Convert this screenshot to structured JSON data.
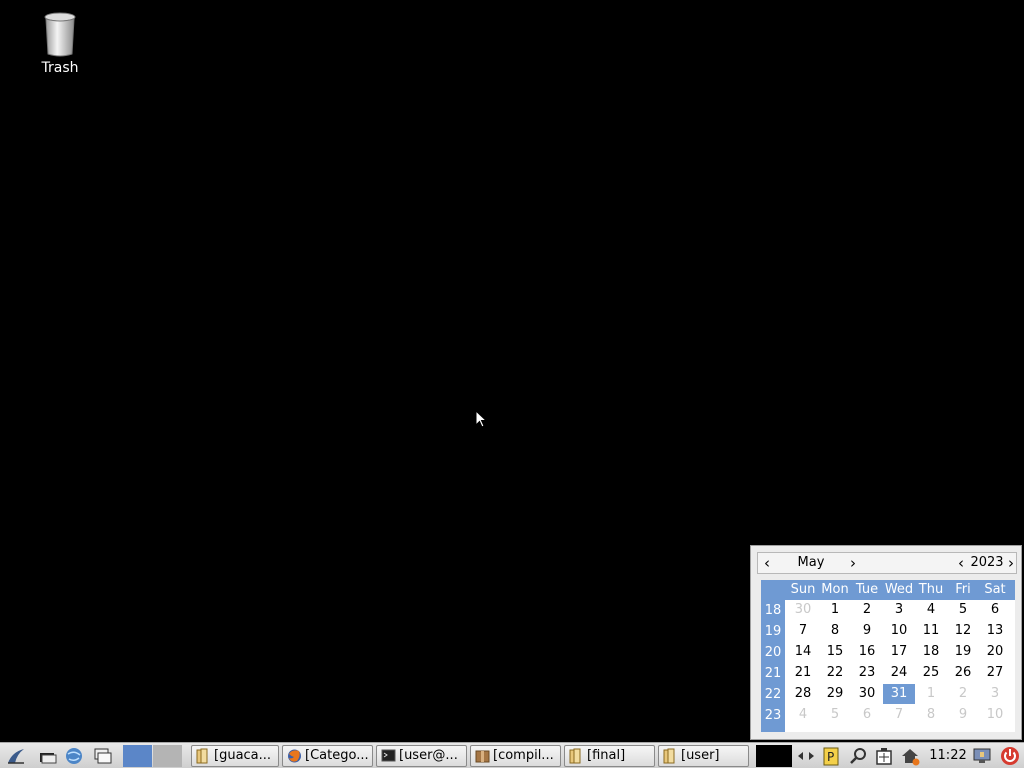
{
  "desktop": {
    "icons": [
      {
        "label": "Trash",
        "icon": "trash-icon"
      }
    ]
  },
  "calendar": {
    "month": "May",
    "year": "2023",
    "prev_arrow": "‹",
    "next_arrow": "›",
    "day_headers": [
      "Sun",
      "Mon",
      "Tue",
      "Wed",
      "Thu",
      "Fri",
      "Sat"
    ],
    "week_numbers": [
      "18",
      "19",
      "20",
      "21",
      "22",
      "23"
    ],
    "weeks": [
      [
        "30",
        "1",
        "2",
        "3",
        "4",
        "5",
        "6"
      ],
      [
        "7",
        "8",
        "9",
        "10",
        "11",
        "12",
        "13"
      ],
      [
        "14",
        "15",
        "16",
        "17",
        "18",
        "19",
        "20"
      ],
      [
        "21",
        "22",
        "23",
        "24",
        "25",
        "26",
        "27"
      ],
      [
        "28",
        "29",
        "30",
        "31",
        "1",
        "2",
        "3"
      ],
      [
        "4",
        "5",
        "6",
        "7",
        "8",
        "9",
        "10"
      ]
    ],
    "selected_day": "31",
    "colors": {
      "header_bg": "#6f9ad3",
      "selected_bg": "#6f9ad3",
      "other_month": "#c8c8c8"
    }
  },
  "taskbar": {
    "launchers": [
      "menu-icon",
      "file-manager-icon",
      "browser-icon",
      "show-desktop-icon"
    ],
    "tasks": [
      {
        "label": "[guaca...",
        "icon": "folder-icon"
      },
      {
        "label": "[Catego...",
        "icon": "firefox-icon"
      },
      {
        "label": "[user@...",
        "icon": "terminal-icon"
      },
      {
        "label": "[compil...",
        "icon": "archive-icon"
      },
      {
        "label": "[final]",
        "icon": "folder-icon"
      },
      {
        "label": "[user]",
        "icon": "folder-icon"
      }
    ],
    "tray": [
      "cpu-monitor",
      "network-icon",
      "clipboard-icon",
      "search-icon",
      "battery-icon",
      "update-icon"
    ],
    "clock": "11:22",
    "end_icons": [
      "screen-lock-icon",
      "power-icon"
    ]
  }
}
